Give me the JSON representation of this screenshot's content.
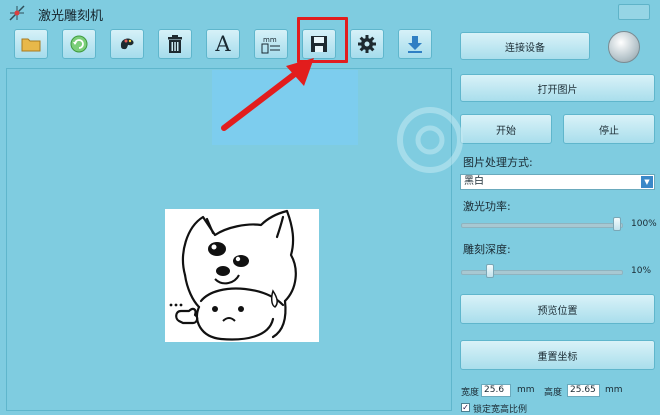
{
  "window": {
    "title": "激光雕刻机"
  },
  "toolbar": {
    "buttons": [
      {
        "name": "open-folder",
        "icon": "folder-icon"
      },
      {
        "name": "refresh",
        "icon": "refresh-icon"
      },
      {
        "name": "image-edit",
        "icon": "palette-icon"
      },
      {
        "name": "delete",
        "icon": "trash-icon"
      },
      {
        "name": "text",
        "icon": "text-icon",
        "glyph": "A"
      },
      {
        "name": "measure",
        "icon": "ruler-icon",
        "glyph": "mm"
      },
      {
        "name": "save",
        "icon": "save-icon",
        "highlighted": true
      },
      {
        "name": "settings",
        "icon": "gear-icon"
      },
      {
        "name": "download",
        "icon": "download-icon"
      }
    ]
  },
  "right_panel": {
    "connect_label": "连接设备",
    "open_image_label": "打开图片",
    "start_label": "开始",
    "stop_label": "停止",
    "processing_label": "图片处理方式:",
    "processing_value": "黑白",
    "power_label": "激光功率:",
    "power_value": "100%",
    "power_level": 1.0,
    "depth_label": "雕刻深度:",
    "depth_value": "10%",
    "depth_level": 0.1,
    "preview_position_label": "预览位置",
    "reset_coords_label": "重置坐标",
    "width_label": "宽度",
    "width_value": "25.6",
    "width_unit": "mm",
    "height_label": "高度",
    "height_value": "25.65",
    "height_unit": "mm",
    "keep_ratio_label": "锁定宽高比例",
    "keep_ratio_checked": true
  },
  "annotation": {
    "color": "#e21d1d"
  }
}
